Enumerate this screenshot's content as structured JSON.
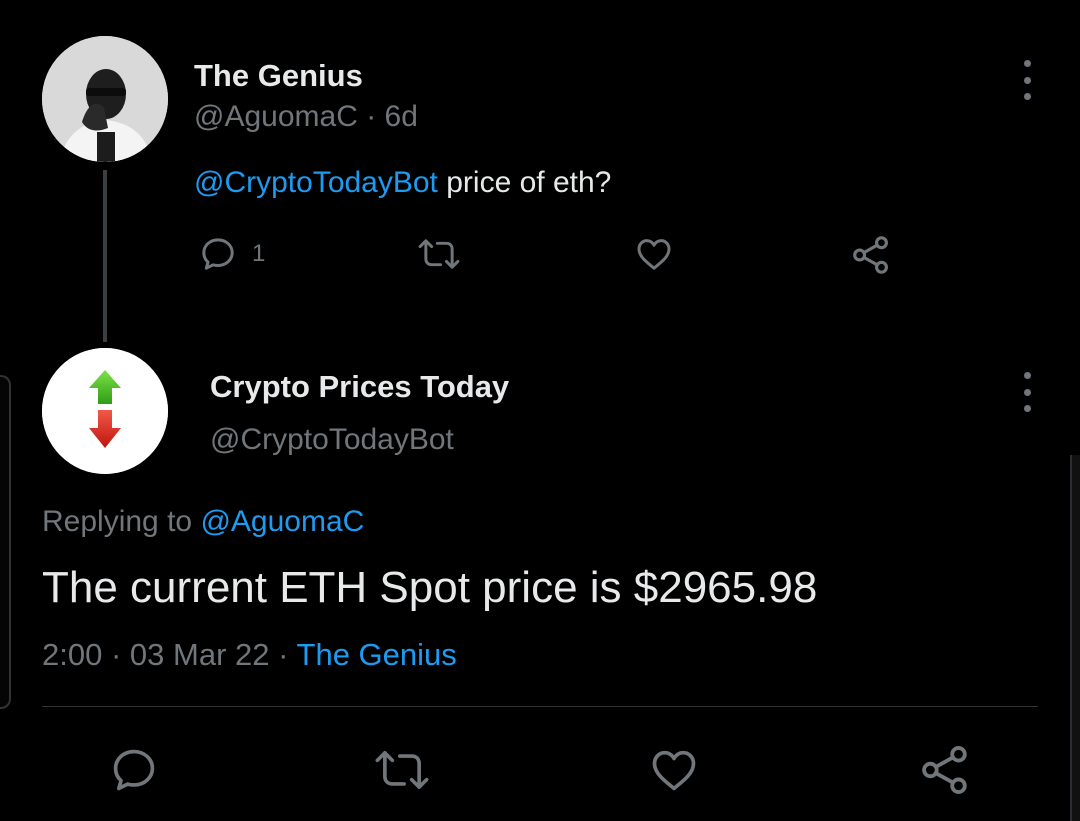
{
  "parent_tweet": {
    "author_name": "The Genius",
    "handle": "@AguomaC",
    "separator": "·",
    "age": "6d",
    "mention": "@CryptoTodayBot",
    "text": " price of eth?",
    "reply_count": "1",
    "icons": [
      "reply-icon",
      "retweet-icon",
      "like-icon",
      "share-icon",
      "more-icon"
    ]
  },
  "reply_tweet": {
    "author_name": "Crypto Prices Today",
    "handle": "@CryptoTodayBot",
    "replying_prefix": "Replying to ",
    "replying_to": "@AguomaC",
    "text": "The current ETH Spot price is $2965.98",
    "time": "2:00",
    "date": "03 Mar 22",
    "separator": "·",
    "via": "The Genius",
    "icons": [
      "reply-icon",
      "retweet-icon",
      "like-icon",
      "share-icon",
      "more-icon"
    ]
  },
  "colors": {
    "background": "#000000",
    "text": "#e7e9ea",
    "secondary": "#71767b",
    "link": "#1d9bf0",
    "arrow_up": "#3fbf1f",
    "arrow_down": "#e0231c"
  }
}
